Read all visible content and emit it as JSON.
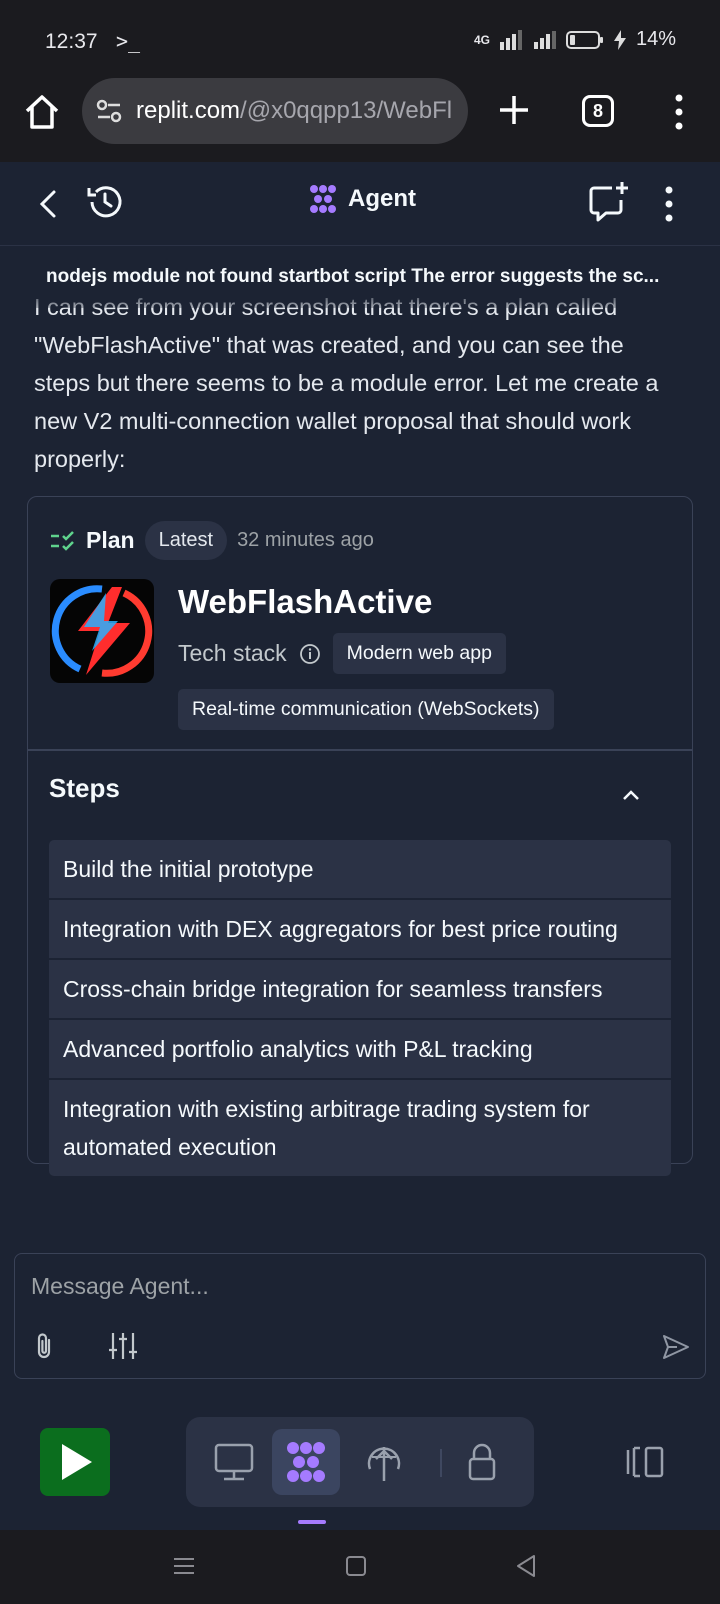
{
  "status_bar": {
    "time": "12:37",
    "terminal_glyph": ">_",
    "network": "4G",
    "battery": "14%"
  },
  "browser": {
    "url_host": "replit.com",
    "url_path": "/@x0qqpp13/WebFl",
    "tab_count": "8"
  },
  "header": {
    "title": "Agent"
  },
  "chat": {
    "subject": "nodejs module not found startbot script The error suggests the sc...",
    "message": "I can see from your screenshot that there's a plan called \"WebFlashActive\" that was created, and you can see the steps but there seems to be a module error. Let me create a new V2 multi-connection wallet proposal that should work properly:"
  },
  "plan": {
    "label": "Plan",
    "badge": "Latest",
    "time": "32 minutes ago",
    "app_name": "WebFlashActive",
    "tech_stack_label": "Tech stack",
    "tags": [
      "Modern web app",
      "Real-time communication (WebSockets)"
    ],
    "steps_title": "Steps",
    "steps": [
      "Build the initial prototype",
      "Integration with DEX aggregators for best price routing",
      "Cross-chain bridge integration for seamless transfers",
      "Advanced portfolio analytics with P&L tracking",
      "Integration with existing arbitrage trading system for automated execution"
    ]
  },
  "composer": {
    "placeholder": "Message Agent..."
  },
  "colors": {
    "background": "#1c2333",
    "surface": "#2b3245",
    "accent_purple": "#a57bff",
    "run_green": "#0b6e1e",
    "plan_icon_green": "#5fd38d"
  }
}
